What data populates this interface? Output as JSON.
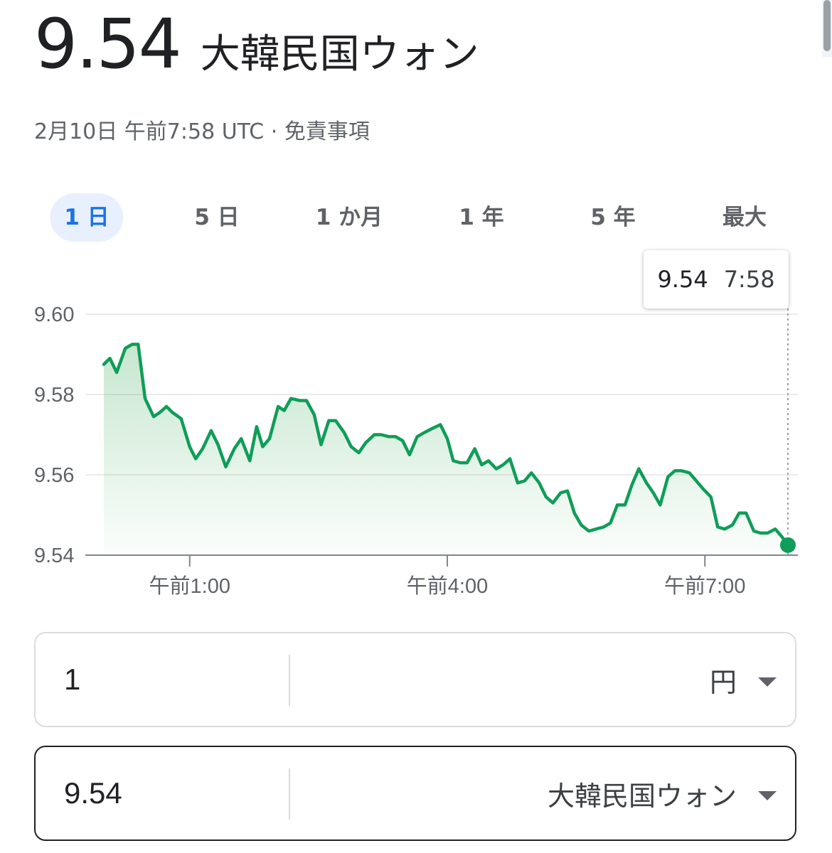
{
  "header": {
    "value": "9.54",
    "currency": "大韓民国ウォン",
    "timestamp": "2月10日 午前7:58 UTC",
    "separator": "·",
    "disclaimer": "免責事項"
  },
  "tabs": [
    {
      "label": "1 日",
      "active": true
    },
    {
      "label": "5 日",
      "active": false
    },
    {
      "label": "1 か月",
      "active": false
    },
    {
      "label": "1 年",
      "active": false
    },
    {
      "label": "5 年",
      "active": false
    },
    {
      "label": "最大",
      "active": false
    }
  ],
  "tooltip": {
    "value": "9.54",
    "time": "7:58"
  },
  "chart_data": {
    "type": "area",
    "title": "",
    "xlabel": "",
    "ylabel": "",
    "ylim": [
      9.54,
      9.6
    ],
    "yticks": [
      "9.60",
      "9.58",
      "9.56",
      "9.54"
    ],
    "xlim": [
      0.0,
      7.967
    ],
    "xticks": [
      {
        "x": 1.0,
        "label": "午前1:00"
      },
      {
        "x": 4.0,
        "label": "午前4:00"
      },
      {
        "x": 7.0,
        "label": "午前7:00"
      }
    ],
    "x": [
      0.0,
      0.07,
      0.15,
      0.25,
      0.33,
      0.4,
      0.48,
      0.58,
      0.65,
      0.73,
      0.8,
      0.9,
      1.0,
      1.07,
      1.15,
      1.25,
      1.33,
      1.42,
      1.52,
      1.6,
      1.7,
      1.78,
      1.85,
      1.93,
      2.03,
      2.1,
      2.18,
      2.28,
      2.36,
      2.45,
      2.53,
      2.62,
      2.7,
      2.8,
      2.88,
      2.97,
      3.05,
      3.15,
      3.23,
      3.32,
      3.4,
      3.48,
      3.56,
      3.65,
      3.73,
      3.82,
      3.92,
      4.0,
      4.07,
      4.15,
      4.23,
      4.32,
      4.4,
      4.48,
      4.57,
      4.65,
      4.73,
      4.82,
      4.9,
      4.98,
      5.07,
      5.15,
      5.23,
      5.32,
      5.4,
      5.48,
      5.56,
      5.65,
      5.73,
      5.82,
      5.9,
      5.98,
      6.07,
      6.15,
      6.23,
      6.32,
      6.4,
      6.48,
      6.57,
      6.65,
      6.73,
      6.82,
      6.9,
      6.98,
      7.07,
      7.15,
      7.23,
      7.32,
      7.4,
      7.48,
      7.57,
      7.65,
      7.73,
      7.82,
      7.9,
      7.967
    ],
    "series": [
      {
        "values": [
          9.5875,
          9.589,
          9.5855,
          9.5915,
          9.5925,
          9.5925,
          9.579,
          9.5745,
          9.5755,
          9.577,
          9.5755,
          9.574,
          9.567,
          9.564,
          9.5665,
          9.571,
          9.5675,
          9.562,
          9.5665,
          9.569,
          9.5635,
          9.572,
          9.567,
          9.569,
          9.577,
          9.576,
          9.579,
          9.5785,
          9.5785,
          9.575,
          9.5675,
          9.5735,
          9.5735,
          9.5705,
          9.567,
          9.5655,
          9.568,
          9.57,
          9.57,
          9.5695,
          9.5695,
          9.5685,
          9.565,
          9.5695,
          9.5705,
          9.5715,
          9.5725,
          9.569,
          9.5635,
          9.563,
          9.563,
          9.5665,
          9.5625,
          9.5635,
          9.5615,
          9.5625,
          9.564,
          9.558,
          9.5585,
          9.5605,
          9.558,
          9.5545,
          9.553,
          9.5555,
          9.556,
          9.5505,
          9.5475,
          9.546,
          9.5465,
          9.547,
          9.548,
          9.5525,
          9.5525,
          9.5575,
          9.5615,
          9.558,
          9.5555,
          9.5525,
          9.5595,
          9.561,
          9.561,
          9.5605,
          9.5585,
          9.5565,
          9.5545,
          9.547,
          9.5465,
          9.5475,
          9.5505,
          9.5505,
          9.546,
          9.5455,
          9.5455,
          9.5465,
          9.5445,
          9.5425
        ]
      }
    ],
    "line_color": "#0f9d58",
    "area_fill": "gradient",
    "grid": true
  },
  "converter": {
    "from": {
      "amount": "1",
      "currency": "円"
    },
    "to": {
      "amount": "9.54",
      "currency": "大韓民国ウォン"
    }
  }
}
